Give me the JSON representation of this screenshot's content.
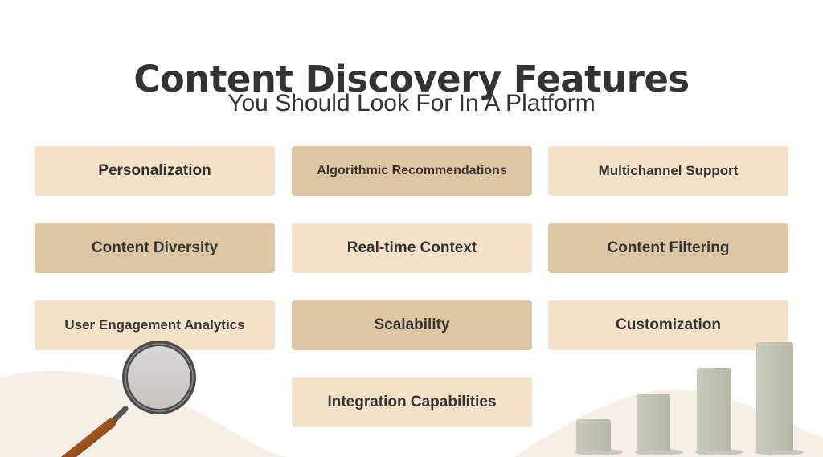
{
  "header": {
    "title": "Content Discovery Features",
    "subtitle": "You Should Look For In A Platform"
  },
  "features": [
    {
      "label": "Personalization",
      "tone": "light"
    },
    {
      "label": "Algorithmic Recommendations",
      "tone": "dark"
    },
    {
      "label": "Multichannel Support",
      "tone": "light"
    },
    {
      "label": "Content Diversity",
      "tone": "dark"
    },
    {
      "label": "Real-time Context",
      "tone": "light"
    },
    {
      "label": "Content Filtering",
      "tone": "dark"
    },
    {
      "label": "User Engagement Analytics",
      "tone": "light"
    },
    {
      "label": "Scalability",
      "tone": "dark"
    },
    {
      "label": "Customization",
      "tone": "light"
    },
    {
      "label": "Integration Capabilities",
      "tone": "light"
    }
  ],
  "decor": {
    "left_icon": "magnifying-glass-icon",
    "right_icon": "bar-chart-icon"
  },
  "colors": {
    "card_light": "#f3e2c8",
    "card_dark": "#dfc6a2",
    "text": "#333333",
    "wave": "#f6efe8"
  }
}
